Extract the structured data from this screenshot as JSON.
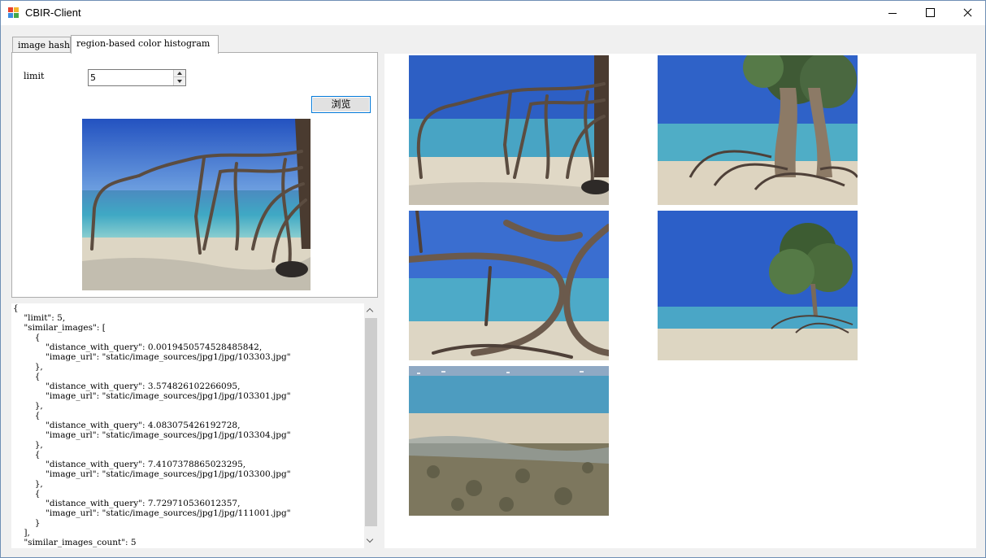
{
  "window": {
    "title": "CBIR-Client",
    "controls": {
      "minimize_icon": "minimize-icon",
      "maximize_icon": "maximize-icon",
      "close_icon": "close-icon"
    }
  },
  "tabs": [
    {
      "label": "image hash",
      "active": false
    },
    {
      "label": "region-based color histogram",
      "active": true
    }
  ],
  "form": {
    "limit_label": "limit",
    "limit_value": "5",
    "browse_label": "浏览"
  },
  "query_image": {
    "description": "beach-driftwood"
  },
  "result_json": "{\n    \"limit\": 5,\n    \"similar_images\": [\n        {\n            \"distance_with_query\": 0.0019450574528485842,\n            \"image_url\": \"static/image_sources/jpg1/jpg/103303.jpg\"\n        },\n        {\n            \"distance_with_query\": 3.574826102266095,\n            \"image_url\": \"static/image_sources/jpg1/jpg/103301.jpg\"\n        },\n        {\n            \"distance_with_query\": 4.083075426192728,\n            \"image_url\": \"static/image_sources/jpg1/jpg/103304.jpg\"\n        },\n        {\n            \"distance_with_query\": 7.4107378865023295,\n            \"image_url\": \"static/image_sources/jpg1/jpg/103300.jpg\"\n        },\n        {\n            \"distance_with_query\": 7.729710536012357,\n            \"image_url\": \"static/image_sources/jpg1/jpg/111001.jpg\"\n        }\n    ],\n    \"similar_images_count\": 5",
  "colors": {
    "sky": "#2f62c9",
    "sea": "#4aa6c8",
    "sand": "#ddd6c4",
    "wood": "#5a4a3e",
    "button_border": "#0078d7"
  }
}
